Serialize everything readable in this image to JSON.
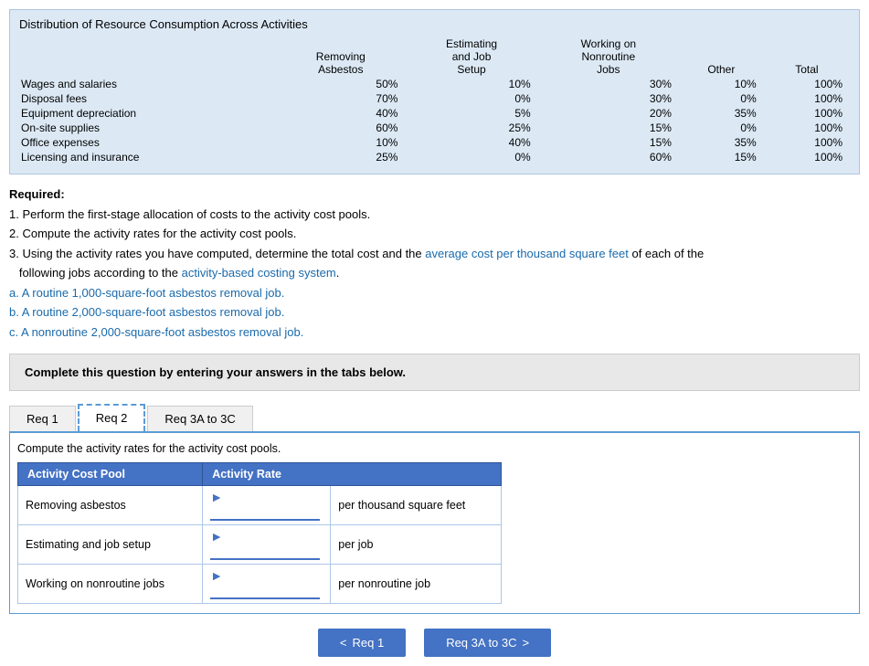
{
  "distribution": {
    "title": "Distribution of Resource Consumption Across Activities",
    "headers": [
      "",
      "Removing\nAsbestos",
      "Estimating\nand Job\nSetup",
      "Working on\nNonroutine\nJobs",
      "Other",
      "Total"
    ],
    "rows": [
      {
        "label": "Wages and salaries",
        "removing": "50%",
        "estimating": "10%",
        "working": "30%",
        "other": "10%",
        "total": "100%"
      },
      {
        "label": "Disposal fees",
        "removing": "70%",
        "estimating": "0%",
        "working": "30%",
        "other": "0%",
        "total": "100%"
      },
      {
        "label": "Equipment depreciation",
        "removing": "40%",
        "estimating": "5%",
        "working": "20%",
        "other": "35%",
        "total": "100%"
      },
      {
        "label": "On-site supplies",
        "removing": "60%",
        "estimating": "25%",
        "working": "15%",
        "other": "0%",
        "total": "100%"
      },
      {
        "label": "Office expenses",
        "removing": "10%",
        "estimating": "40%",
        "working": "15%",
        "other": "35%",
        "total": "100%"
      },
      {
        "label": "Licensing and insurance",
        "removing": "25%",
        "estimating": "0%",
        "working": "60%",
        "other": "15%",
        "total": "100%"
      }
    ]
  },
  "required": {
    "heading": "Required:",
    "items": [
      "1. Perform the first-stage allocation of costs to the activity cost pools.",
      "2. Compute the activity rates for the activity cost pools.",
      "3. Using the activity rates you have computed, determine the total cost and the average cost per thousand square feet of each of the following jobs according to the activity-based costing system.",
      "a. A routine 1,000-square-foot asbestos removal job.",
      "b. A routine 2,000-square-foot asbestos removal job.",
      "c. A nonroutine 2,000-square-foot asbestos removal job."
    ]
  },
  "complete_box": {
    "text": "Complete this question by entering your answers in the tabs below."
  },
  "tabs": [
    {
      "label": "Req 1",
      "id": "req1",
      "active": false
    },
    {
      "label": "Req 2",
      "id": "req2",
      "active": true
    },
    {
      "label": "Req 3A to 3C",
      "id": "req3a3c",
      "active": false
    }
  ],
  "tab_content": {
    "description": "Compute the activity rates for the activity cost pools.",
    "table": {
      "headers": [
        "Activity Cost Pool",
        "Activity Rate"
      ],
      "rows": [
        {
          "pool": "Removing asbestos",
          "rate": "",
          "unit": "per thousand square feet"
        },
        {
          "pool": "Estimating and job setup",
          "rate": "",
          "unit": "per job"
        },
        {
          "pool": "Working on nonroutine jobs",
          "rate": "",
          "unit": "per nonroutine job"
        }
      ]
    }
  },
  "nav_buttons": {
    "prev": {
      "label": "Req 1",
      "icon": "<"
    },
    "next": {
      "label": "Req 3A to 3C",
      "icon": ">"
    }
  }
}
